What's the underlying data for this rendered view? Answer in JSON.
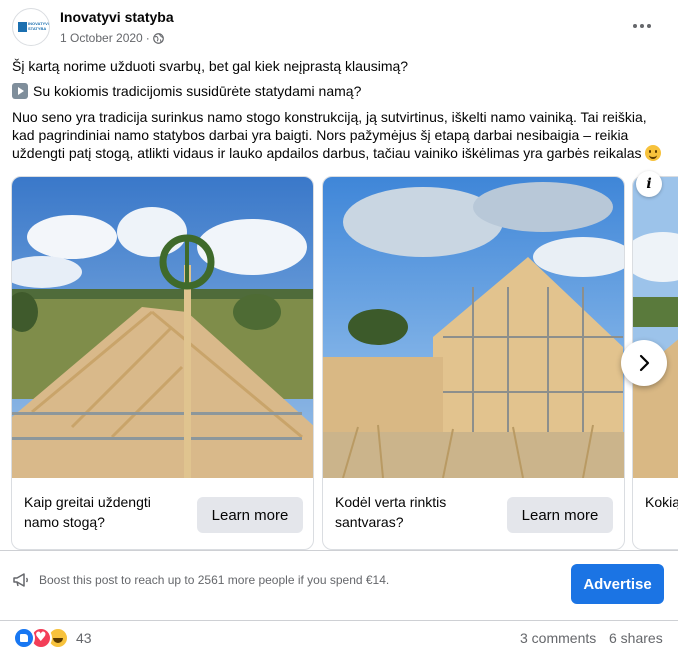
{
  "post": {
    "page_name": "Inovatyvi statyba",
    "avatar_text": "INOVATYVI STATYBA",
    "date": "1 October 2020",
    "meta_separator": "·",
    "line1": "Šį kartą norime užduoti svarbų, bet gal kiek neįprastą klausimą?",
    "line2": "Su kokiomis tradicijomis susidūrėte statydami namą?",
    "line3": "Nuo seno yra tradicija surinkus namo stogo konstrukciją, ją sutvirtinus, iškelti namo vainiką. Tai reiškia, kad pagrindiniai namo statybos darbai yra baigti. Nors pažymėjus šį etapą darbai nesibaigia – reikia uždengti patį stogą, atlikti vidaus ir lauko apdailos darbus, tačiau vainiko iškėlimas yra garbės reikalas"
  },
  "carousel": {
    "cards": [
      {
        "caption": "Kaip greitai uždengti namo stogą?",
        "button": "Learn more",
        "image": "roof-wreath-photo"
      },
      {
        "caption": "Kodėl verta rinktis santvaras?",
        "button": "Learn more",
        "image": "timber-frame-house-photo"
      },
      {
        "caption": "Kokią stogu",
        "button": "",
        "image": "partial-card-photo"
      }
    ],
    "info_glyph": "i"
  },
  "boost": {
    "text": "Boost this post to reach up to 2561 more people if you spend €14.",
    "button": "Advertise"
  },
  "footer": {
    "reaction_count": "43",
    "comments": "3 comments",
    "shares": "6 shares"
  },
  "colors": {
    "accent": "#1b74e4",
    "secondary_text": "#65676b",
    "button_bg": "#e4e6eb"
  }
}
